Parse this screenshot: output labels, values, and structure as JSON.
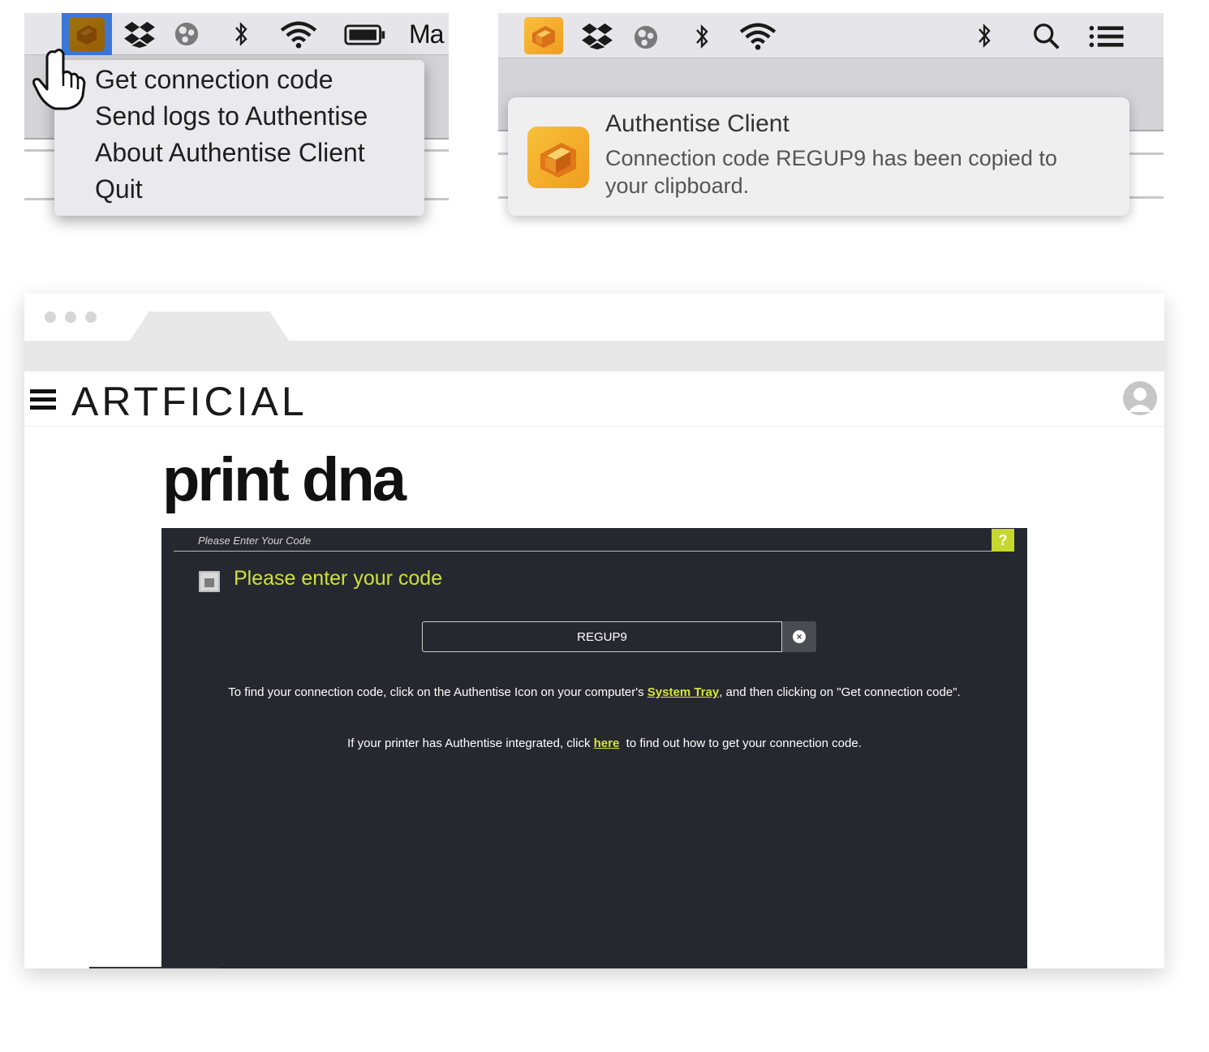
{
  "menubar_left": {
    "edge_text": "Ma",
    "dropdown_items": [
      "Get connection code",
      "Send logs to Authentise",
      "About Authentise Client",
      "Quit"
    ],
    "icons": [
      "authentise-icon",
      "dropbox-icon",
      "globe-icon",
      "bluetooth-icon",
      "wifi-icon",
      "battery-icon"
    ]
  },
  "menubar_right": {
    "icons": [
      "authentise-icon",
      "dropbox-icon",
      "globe-icon",
      "bluetooth-icon",
      "wifi-icon",
      "bluetooth-icon",
      "search-icon",
      "list-icon"
    ]
  },
  "notification": {
    "title": "Authentise Client",
    "body": "Connection code REGUP9 has been copied to your clipboard."
  },
  "site": {
    "brand": "ARTFICIAL",
    "page_title": "print dna"
  },
  "code_panel": {
    "header": "Please Enter Your Code",
    "help_label": "?",
    "title": "Please enter your code",
    "code_value": "REGUP9",
    "instruction_prefix": "To find your connection code, click on the Authentise Icon on your computer's ",
    "instruction_link": "System Tray",
    "instruction_suffix": ", and then clicking on \"Get connection code\".",
    "printer_prefix": "If your printer has Authentise integrated, click ",
    "printer_link": "here",
    "printer_suffix": "  to find out how to get your connection code."
  },
  "colors": {
    "accent": "#cfe03a",
    "panel_bg": "#262830",
    "menu_selection": "#3d77d6",
    "authentise_orange": "#f4b02d"
  }
}
